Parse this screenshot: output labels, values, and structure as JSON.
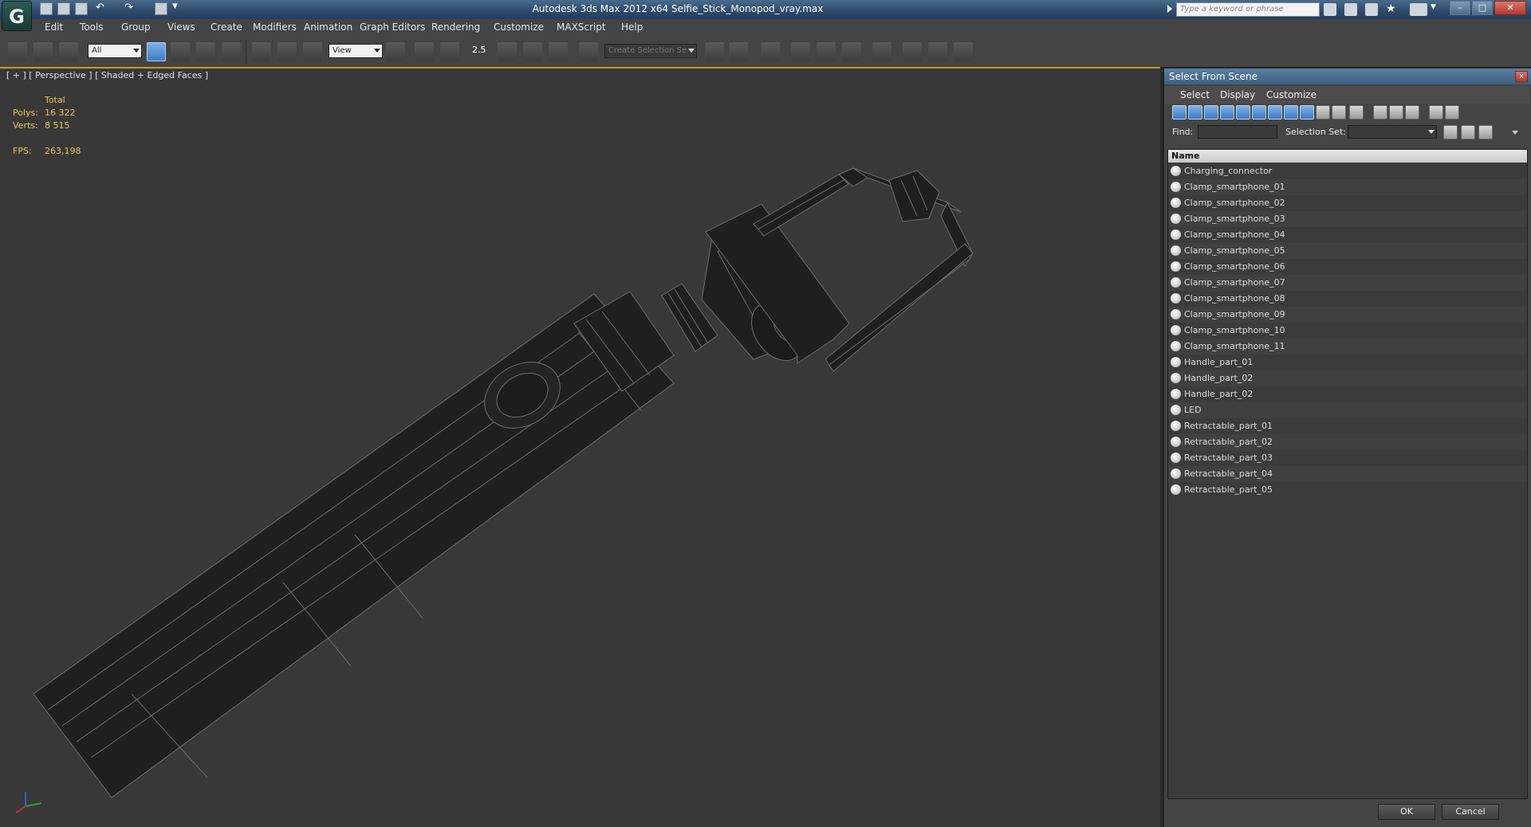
{
  "window": {
    "title": "Autodesk 3ds Max  2012 x64     Selfie_Stick_Monopod_vray.max",
    "search_placeholder": "Type a keyword or phrase",
    "logo": "G"
  },
  "menu": [
    "Edit",
    "Tools",
    "Group",
    "Views",
    "Create",
    "Modifiers",
    "Animation",
    "Graph Editors",
    "Rendering",
    "Customize",
    "MAXScript",
    "Help"
  ],
  "toolbar": {
    "filter_value": "All",
    "coord_value": "View",
    "selection_set_placeholder": "Create Selection Se",
    "snap_label": "2.5"
  },
  "viewport": {
    "label": "[ + ] [ Perspective ] [ Shaded + Edged Faces ]",
    "stats": {
      "total_label": "Total",
      "polys_label": "Polys:",
      "polys_value": "16 322",
      "verts_label": "Verts:",
      "verts_value": "8 515",
      "fps_label": "FPS:",
      "fps_value": "263,198"
    }
  },
  "scene_explorer": {
    "title": "Select From Scene",
    "close_glyph": "x",
    "menus": [
      "Select",
      "Display",
      "Customize"
    ],
    "find_label": "Find:",
    "selection_set_label": "Selection Set:",
    "column_header": "Name",
    "items": [
      "Charging_connector",
      "Clamp_smartphone_01",
      "Clamp_smartphone_02",
      "Clamp_smartphone_03",
      "Clamp_smartphone_04",
      "Clamp_smartphone_05",
      "Clamp_smartphone_06",
      "Clamp_smartphone_07",
      "Clamp_smartphone_08",
      "Clamp_smartphone_09",
      "Clamp_smartphone_10",
      "Clamp_smartphone_11",
      "Handle_part_01",
      "Handle_part_02",
      "Handle_part_02",
      "LED",
      "Retractable_part_01",
      "Retractable_part_02",
      "Retractable_part_03",
      "Retractable_part_04",
      "Retractable_part_05"
    ],
    "ok_label": "OK",
    "cancel_label": "Cancel"
  },
  "colors": {
    "accent": "#c89a1e",
    "title_bar": "#2d4a6b",
    "viewport_bg": "#383838",
    "stats_text": "#e8c65a"
  }
}
